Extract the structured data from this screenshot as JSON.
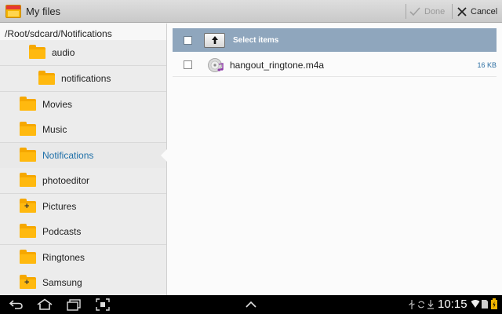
{
  "header": {
    "title": "My files",
    "done_label": "Done",
    "cancel_label": "Cancel"
  },
  "left_pane": {
    "path": "/Root/sdcard/Notifications",
    "items": [
      {
        "label": "audio"
      },
      {
        "label": "notifications"
      },
      {
        "label": "Movies"
      },
      {
        "label": "Music"
      },
      {
        "label": "Notifications"
      },
      {
        "label": "photoeditor"
      },
      {
        "label": "Pictures"
      },
      {
        "label": "Podcasts"
      },
      {
        "label": "Ringtones"
      },
      {
        "label": "Samsung"
      }
    ]
  },
  "right_pane": {
    "select_label": "Select items",
    "files": [
      {
        "name": "hangout_ringtone.m4a",
        "size": "16 KB"
      }
    ]
  },
  "status_bar": {
    "time": "10:15"
  },
  "colors": {
    "accent": "#1d6fa8",
    "select_bar": "#8fa6bd",
    "folder": "#ffb90f"
  }
}
